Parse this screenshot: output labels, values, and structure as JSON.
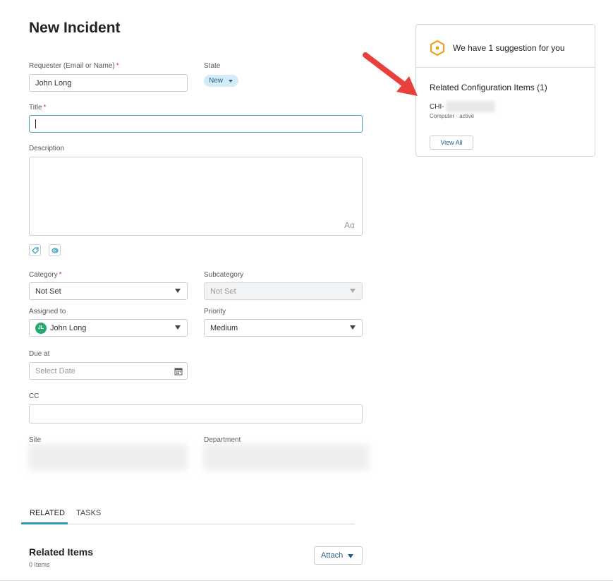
{
  "page": {
    "title": "New Incident"
  },
  "form": {
    "requester": {
      "label": "Requester (Email or Name)",
      "required_mark": "*",
      "value": "John Long"
    },
    "state": {
      "label": "State",
      "value": "New"
    },
    "title": {
      "label": "Title",
      "required_mark": "*",
      "value": ""
    },
    "description": {
      "label": "Description",
      "format_glyph": "Aα"
    },
    "category": {
      "label": "Category",
      "required_mark": "*",
      "value": "Not Set"
    },
    "subcategory": {
      "label": "Subcategory",
      "value": "Not Set"
    },
    "assigned_to": {
      "label": "Assigned to",
      "value": "John Long",
      "initials": "JL"
    },
    "priority": {
      "label": "Priority",
      "value": "Medium"
    },
    "due_at": {
      "label": "Due at",
      "placeholder": "Select Date"
    },
    "cc": {
      "label": "CC",
      "value": ""
    },
    "site": {
      "label": "Site"
    },
    "department": {
      "label": "Department"
    }
  },
  "tabs": [
    {
      "label": "RELATED",
      "active": true
    },
    {
      "label": "TASKS",
      "active": false
    }
  ],
  "related_items": {
    "title": "Related Items",
    "count_text": "0 Items",
    "attach_label": "Attach"
  },
  "suggestion_card": {
    "header": "We have 1 suggestion for you",
    "section_title": "Related Configuration Items (1)",
    "ci_prefix": "CHI-",
    "ci_meta": "Computer · active",
    "view_all_label": "View All"
  },
  "colors": {
    "accent": "#2a9bb5",
    "required": "#d9303b",
    "arrow": "#e8403c",
    "suggestion_icon": "#f0a020",
    "avatar": "#23a96b"
  }
}
